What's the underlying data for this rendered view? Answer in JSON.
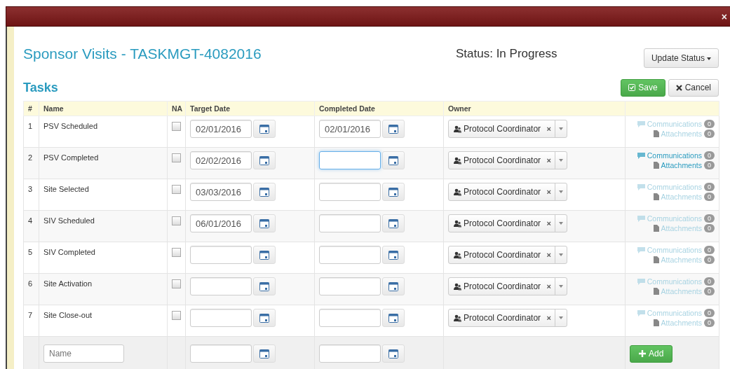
{
  "dialog": {
    "close": "×",
    "title": "Sponsor Visits - TASKMGT-4082016",
    "status": "Status: In Progress",
    "update_status": "Update Status"
  },
  "tasks": {
    "heading": "Tasks",
    "save": "Save",
    "cancel": "Cancel"
  },
  "table": {
    "columns": [
      "#",
      "Name",
      "NA",
      "Target Date",
      "Completed Date",
      "Owner"
    ],
    "rows": [
      {
        "num": "1",
        "name": "PSV Scheduled",
        "na": false,
        "target_date": "02/01/2016",
        "completed_date": "02/01/2016",
        "completed_focused": false,
        "owner": "Protocol Coordinator",
        "remove": "×",
        "communications": "Communications",
        "communications_count": "0",
        "attachments": "Attachments",
        "attachments_count": "0",
        "links_disabled": true
      },
      {
        "num": "2",
        "name": "PSV Completed",
        "na": false,
        "target_date": "02/02/2016",
        "completed_date": "",
        "completed_focused": true,
        "owner": "Protocol Coordinator",
        "remove": "×",
        "communications": "Communications",
        "communications_count": "0",
        "attachments": "Attachments",
        "attachments_count": "0",
        "links_disabled": false
      },
      {
        "num": "3",
        "name": "Site Selected",
        "na": false,
        "target_date": "03/03/2016",
        "completed_date": "",
        "completed_focused": false,
        "owner": "Protocol Coordinator",
        "remove": "×",
        "communications": "Communications",
        "communications_count": "0",
        "attachments": "Attachments",
        "attachments_count": "0",
        "links_disabled": true
      },
      {
        "num": "4",
        "name": "SIV Scheduled",
        "na": false,
        "target_date": "06/01/2016",
        "completed_date": "",
        "completed_focused": false,
        "owner": "Protocol Coordinator",
        "remove": "×",
        "communications": "Communications",
        "communications_count": "0",
        "attachments": "Attachments",
        "attachments_count": "0",
        "links_disabled": true
      },
      {
        "num": "5",
        "name": "SIV Completed",
        "na": false,
        "target_date": "",
        "completed_date": "",
        "completed_focused": false,
        "owner": "Protocol Coordinator",
        "remove": "×",
        "communications": "Communications",
        "communications_count": "0",
        "attachments": "Attachments",
        "attachments_count": "0",
        "links_disabled": true
      },
      {
        "num": "6",
        "name": "Site Activation",
        "na": false,
        "target_date": "",
        "completed_date": "",
        "completed_focused": false,
        "owner": "Protocol Coordinator",
        "remove": "×",
        "communications": "Communications",
        "communications_count": "0",
        "attachments": "Attachments",
        "attachments_count": "0",
        "links_disabled": true
      },
      {
        "num": "7",
        "name": "Site Close-out",
        "na": false,
        "target_date": "",
        "completed_date": "",
        "completed_focused": false,
        "owner": "Protocol Coordinator",
        "remove": "×",
        "communications": "Communications",
        "communications_count": "0",
        "attachments": "Attachments",
        "attachments_count": "0",
        "links_disabled": true
      }
    ],
    "new_row": {
      "name_placeholder": "Name",
      "add": "Add"
    }
  }
}
